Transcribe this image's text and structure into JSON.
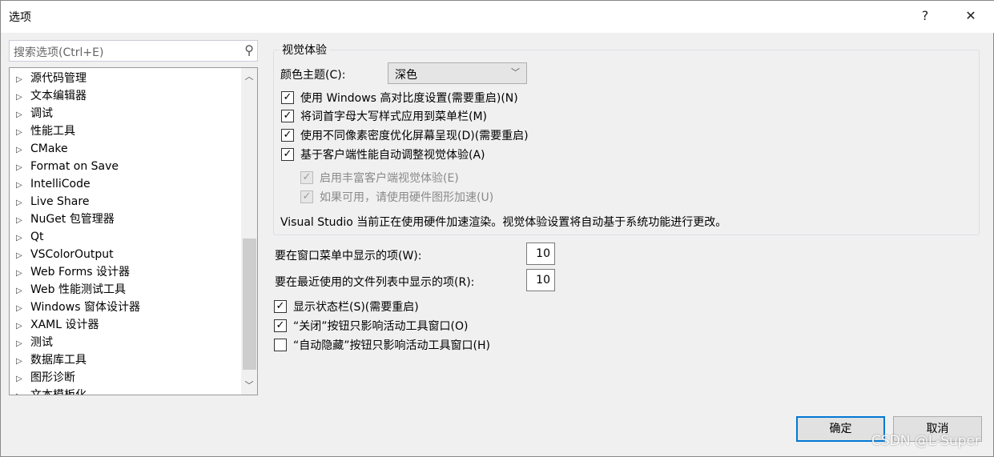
{
  "window": {
    "title": "选项",
    "help": "?",
    "close": "✕"
  },
  "search": {
    "placeholder": "搜索选项(Ctrl+E)"
  },
  "tree": {
    "items": [
      "源代码管理",
      "文本编辑器",
      "调试",
      "性能工具",
      "CMake",
      "Format on Save",
      "IntelliCode",
      "Live Share",
      "NuGet 包管理器",
      "Qt",
      "VSColorOutput",
      "Web Forms 设计器",
      "Web 性能测试工具",
      "Windows 窗体设计器",
      "XAML 设计器",
      "测试",
      "数据库工具",
      "图形诊断",
      "文本模板化"
    ],
    "scroll_position": 0.55
  },
  "visual": {
    "group_title": "视觉体验",
    "theme_label": "颜色主题(C):",
    "theme_value": "深色",
    "options": [
      {
        "label": "使用 Windows 高对比度设置(需要重启)(N)",
        "checked": true,
        "enabled": true
      },
      {
        "label": "将词首字母大写样式应用到菜单栏(M)",
        "checked": true,
        "enabled": true
      },
      {
        "label": "使用不同像素密度优化屏幕呈现(D)(需要重启)",
        "checked": true,
        "enabled": true
      },
      {
        "label": "基于客户端性能自动调整视觉体验(A)",
        "checked": true,
        "enabled": true
      },
      {
        "label": "启用丰富客户端视觉体验(E)",
        "checked": true,
        "enabled": false
      },
      {
        "label": "如果可用，请使用硬件图形加速(U)",
        "checked": true,
        "enabled": false
      }
    ],
    "note": "Visual Studio 当前正在使用硬件加速渲染。视觉体验设置将自动基于系统功能进行更改。"
  },
  "window_menu": {
    "label": "要在窗口菜单中显示的项(W):",
    "value": "10"
  },
  "recent_files": {
    "label": "要在最近使用的文件列表中显示的项(R):",
    "value": "10"
  },
  "bottom_options": [
    {
      "label": "显示状态栏(S)(需要重启)",
      "checked": true
    },
    {
      "label": "“关闭”按钮只影响活动工具窗口(O)",
      "checked": true
    },
    {
      "label": "“自动隐藏”按钮只影响活动工具窗口(H)",
      "checked": false
    }
  ],
  "buttons": {
    "ok": "确定",
    "cancel": "取消"
  },
  "watermark": "CSDN @L-Super",
  "colors": {
    "accent": "#0078d7"
  }
}
